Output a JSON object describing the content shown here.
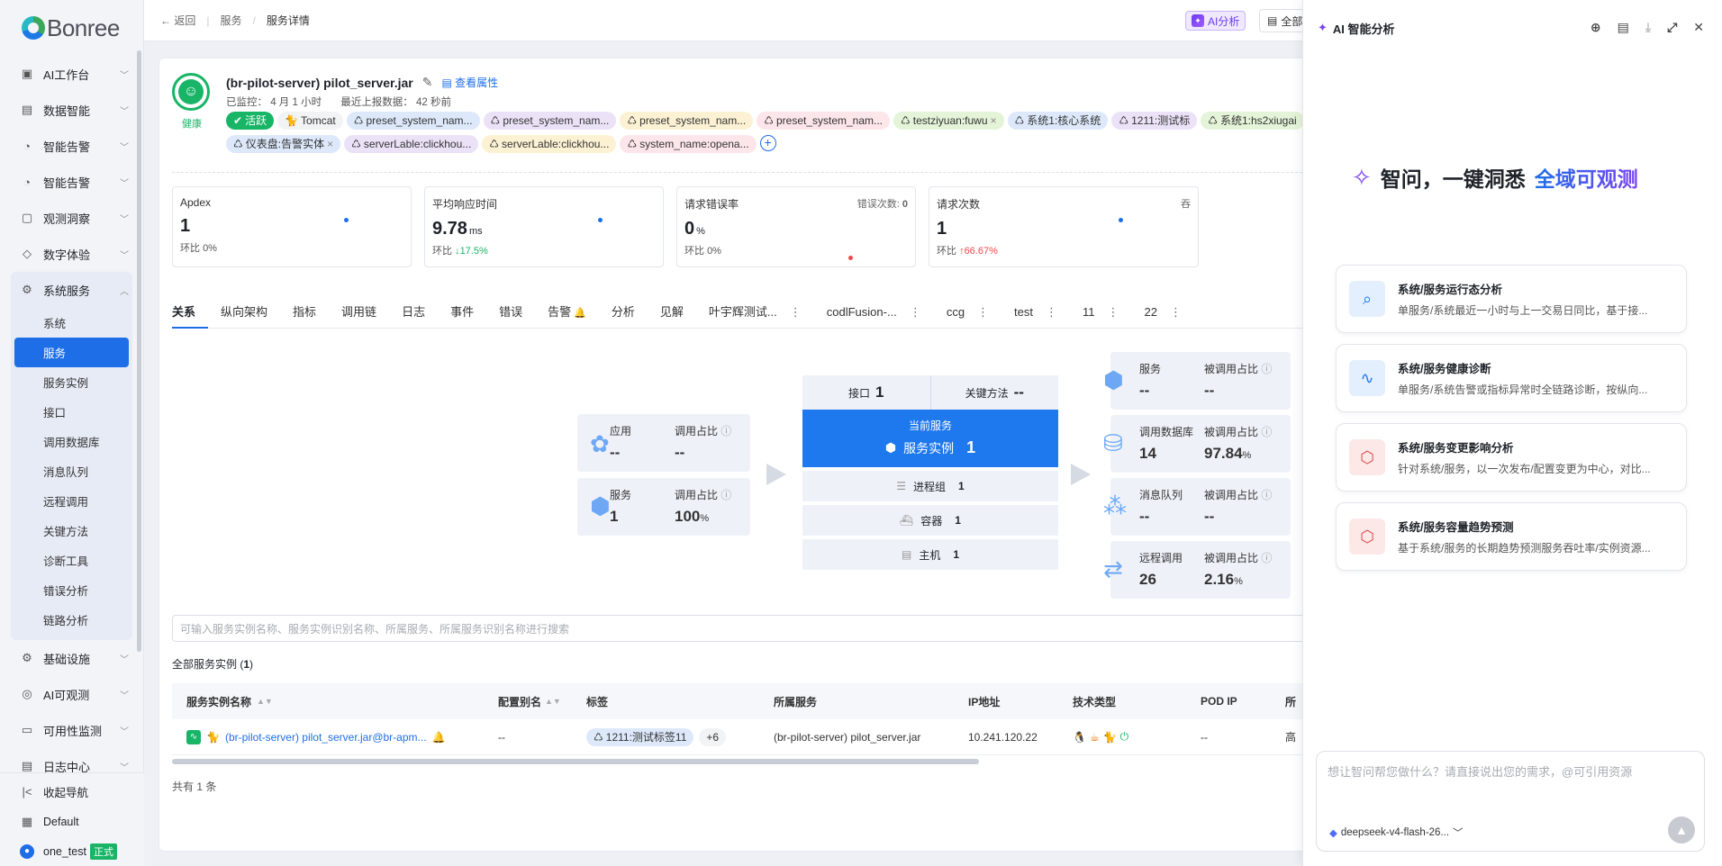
{
  "brand": {
    "name": "Bonree"
  },
  "sidebar": {
    "items": [
      {
        "label": "AI工作台",
        "icon": "ai-workbench-icon"
      },
      {
        "label": "数据智能",
        "icon": "data-intel-icon"
      },
      {
        "label": "智能告警",
        "icon": "alert-icon"
      },
      {
        "label": "智能告警",
        "icon": "alert-icon"
      },
      {
        "label": "观测洞察",
        "icon": "insight-icon"
      },
      {
        "label": "数字体验",
        "icon": "thumb-icon"
      }
    ],
    "group": {
      "label": "系统服务",
      "children": [
        "系统",
        "服务",
        "服务实例",
        "接口",
        "调用数据库",
        "消息队列",
        "远程调用",
        "关键方法",
        "诊断工具",
        "错误分析",
        "链路分析"
      ],
      "active": "服务"
    },
    "items_after": [
      {
        "label": "基础设施"
      },
      {
        "label": "AI可观测"
      },
      {
        "label": "可用性监测"
      },
      {
        "label": "日志中心"
      }
    ],
    "bottom": {
      "collapse": "收起导航",
      "workspace": "Default",
      "user": "one_test",
      "env_badge": "正式"
    }
  },
  "topbar": {
    "back": "返回",
    "crumb1": "服务",
    "crumb2": "服务详情",
    "ai_button": "AI分析",
    "full_button": "全部"
  },
  "service": {
    "health": "健康",
    "title": "(br-pilot-server) pilot_server.jar",
    "view_props": "查看属性",
    "monitored": "已监控： 4 月 1 小时",
    "last_report": "最近上报数据： 42 秒前",
    "tags": [
      {
        "text": "活跃",
        "style": "active"
      },
      {
        "text": "Tomcat",
        "style": "gray"
      },
      {
        "text": "preset_system_nam...",
        "style": "blue"
      },
      {
        "text": "preset_system_nam...",
        "style": "purple"
      },
      {
        "text": "preset_system_nam...",
        "style": "yellow"
      },
      {
        "text": "preset_system_nam...",
        "style": "pink"
      },
      {
        "text": "testziyuan:fuwu",
        "style": "green",
        "close": true
      },
      {
        "text": "系统1:核心系统",
        "style": "blue"
      },
      {
        "text": "1211:测试标",
        "style": "purple"
      },
      {
        "text": "系统1:hs2xiugai",
        "style": "green"
      },
      {
        "text": "仪表盘:告警实体",
        "style": "blue",
        "close": true
      },
      {
        "text": "serverLable:clickhou...",
        "style": "purple"
      },
      {
        "text": "serverLable:clickhou...",
        "style": "yellow"
      },
      {
        "text": "system_name:opena...",
        "style": "pink"
      }
    ]
  },
  "kpis": [
    {
      "title": "Apdex",
      "value": "1",
      "unit": "",
      "compare_label": "环比",
      "compare": "0%",
      "trend": "none"
    },
    {
      "title": "平均响应时间",
      "value": "9.78",
      "unit": "ms",
      "compare_label": "环比",
      "compare": "17.5%",
      "trend": "up"
    },
    {
      "title": "请求错误率",
      "value": "0",
      "unit": "%",
      "compare_label": "环比",
      "compare": "0%",
      "trend": "none",
      "extra_label": "错误次数:",
      "extra_value": "0"
    },
    {
      "title": "请求次数",
      "value": "1",
      "unit": "",
      "compare_label": "环比",
      "compare": "66.67%",
      "trend": "down",
      "extra_label": "吞"
    }
  ],
  "tabs": [
    {
      "label": "关系",
      "active": true
    },
    {
      "label": "纵向架构"
    },
    {
      "label": "指标"
    },
    {
      "label": "调用链"
    },
    {
      "label": "日志"
    },
    {
      "label": "事件"
    },
    {
      "label": "错误"
    },
    {
      "label": "告警",
      "bell": true
    },
    {
      "label": "分析"
    },
    {
      "label": "见解"
    },
    {
      "label": "叶宇辉测试...",
      "more": true
    },
    {
      "label": "codlFusion-...",
      "more": true
    },
    {
      "label": "ccg",
      "more": true
    },
    {
      "label": "test",
      "more": true
    },
    {
      "label": "11",
      "more": true
    },
    {
      "label": "22",
      "more": true
    }
  ],
  "topology": {
    "left": [
      {
        "name": "应用",
        "value": "--",
        "ratio_label": "调用占比",
        "ratio": "--",
        "unit": ""
      },
      {
        "name": "服务",
        "value": "1",
        "ratio_label": "调用占比",
        "ratio": "100",
        "unit": "%"
      }
    ],
    "center": {
      "interface_label": "接口",
      "interface_value": "1",
      "method_label": "关键方法",
      "method_value": "--",
      "current_label": "当前服务",
      "instance_label": "服务实例",
      "instance_value": "1",
      "rows": [
        {
          "label": "进程组",
          "value": "1"
        },
        {
          "label": "容器",
          "value": "1"
        },
        {
          "label": "主机",
          "value": "1"
        }
      ]
    },
    "right": [
      {
        "name": "服务",
        "value": "--",
        "ratio_label": "被调用占比",
        "ratio": "--",
        "unit": ""
      },
      {
        "name": "调用数据库",
        "value": "14",
        "ratio_label": "被调用占比",
        "ratio": "97.84",
        "unit": "%"
      },
      {
        "name": "消息队列",
        "value": "--",
        "ratio_label": "被调用占比",
        "ratio": "--",
        "unit": ""
      },
      {
        "name": "远程调用",
        "value": "26",
        "ratio_label": "被调用占比",
        "ratio": "2.16",
        "unit": "%"
      }
    ]
  },
  "instances": {
    "search_placeholder": "可输入服务实例名称、服务实例识别名称、所属服务、所属服务识别名称进行搜索",
    "title": "全部服务实例",
    "count": "1",
    "columns": [
      "服务实例名称",
      "配置别名",
      "标签",
      "所属服务",
      "IP地址",
      "技术类型",
      "POD IP",
      "所"
    ],
    "rows": [
      {
        "name": "(br-pilot-server) pilot_server.jar@br-apm...",
        "alias": "--",
        "tag": "1211:测试标签11",
        "tag_more": "+6",
        "service": "(br-pilot-server) pilot_server.jar",
        "ip": "10.241.120.22",
        "pod_ip": "--",
        "extra": "高"
      }
    ],
    "total": "共有 1 条"
  },
  "ai_panel": {
    "title": "AI 智能分析",
    "hero_prefix": "智问，一键洞悉",
    "hero_accent": "全域可观测",
    "skills": [
      {
        "title": "系统/服务运行态分析",
        "desc": "单服务/系统最近一小时与上一交易日同比，基于接...",
        "color": "blue"
      },
      {
        "title": "系统/服务健康诊断",
        "desc": "单服务/系统告警或指标异常时全链路诊断，按纵向...",
        "color": "blue"
      },
      {
        "title": "系统/服务变更影响分析",
        "desc": "针对系统/服务，以一次发布/配置变更为中心，对比...",
        "color": "red"
      },
      {
        "title": "系统/服务容量趋势预测",
        "desc": "基于系统/服务的长期趋势预测服务吞吐率/实例资源...",
        "color": "red"
      }
    ],
    "input_placeholder": "想让智问帮您做什么？请直接说出您的需求，@可引用资源",
    "model": "deepseek-v4-flash-26..."
  }
}
